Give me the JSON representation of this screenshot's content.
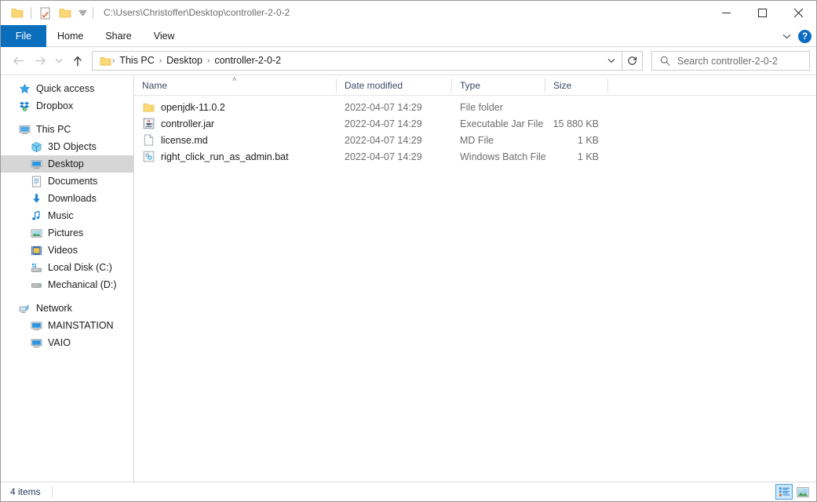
{
  "window": {
    "path_title": "C:\\Users\\Christoffer\\Desktop\\controller-2-0-2",
    "minimize_label": "Minimize",
    "maximize_label": "Maximize",
    "close_label": "Close"
  },
  "quick_access_toolbar": {
    "items": [
      {
        "name": "folder-icon",
        "label": "Explorer"
      },
      {
        "name": "properties-icon",
        "label": "Properties"
      },
      {
        "name": "new-folder-icon",
        "label": "New folder"
      },
      {
        "name": "chevron-down-icon",
        "label": "Customize Quick Access Toolbar"
      }
    ]
  },
  "ribbon": {
    "tabs": [
      {
        "label": "File",
        "active": true
      },
      {
        "label": "Home",
        "active": false
      },
      {
        "label": "Share",
        "active": false
      },
      {
        "label": "View",
        "active": false
      }
    ],
    "collapse_label": "Minimize the Ribbon",
    "help_label": "?"
  },
  "address": {
    "back_label": "Back",
    "forward_label": "Forward",
    "recent_label": "Recent locations",
    "up_label": "Up to Desktop",
    "breadcrumbs": [
      "This PC",
      "Desktop",
      "controller-2-0-2"
    ],
    "separator": "›",
    "dropdown_label": "Previous locations",
    "refresh_label": "Refresh"
  },
  "search": {
    "placeholder": "Search controller-2-0-2",
    "icon": "search-icon"
  },
  "sidebar": {
    "groups": [
      {
        "items": [
          {
            "label": "Quick access",
            "icon": "star-icon",
            "indent": false,
            "selected": false
          },
          {
            "label": "Dropbox",
            "icon": "dropbox-icon",
            "indent": false,
            "selected": false
          }
        ]
      },
      {
        "items": [
          {
            "label": "This PC",
            "icon": "monitor-icon",
            "indent": false,
            "selected": false
          },
          {
            "label": "3D Objects",
            "icon": "cube-icon",
            "indent": true,
            "selected": false
          },
          {
            "label": "Desktop",
            "icon": "desktop-icon",
            "indent": true,
            "selected": true
          },
          {
            "label": "Documents",
            "icon": "documents-icon",
            "indent": true,
            "selected": false
          },
          {
            "label": "Downloads",
            "icon": "download-icon",
            "indent": true,
            "selected": false
          },
          {
            "label": "Music",
            "icon": "music-note-icon",
            "indent": true,
            "selected": false
          },
          {
            "label": "Pictures",
            "icon": "pictures-icon",
            "indent": true,
            "selected": false
          },
          {
            "label": "Videos",
            "icon": "videos-icon",
            "indent": true,
            "selected": false
          },
          {
            "label": "Local Disk (C:)",
            "icon": "system-drive-icon",
            "indent": true,
            "selected": false
          },
          {
            "label": "Mechanical (D:)",
            "icon": "drive-icon",
            "indent": true,
            "selected": false
          }
        ]
      },
      {
        "items": [
          {
            "label": "Network",
            "icon": "network-icon",
            "indent": false,
            "selected": false
          },
          {
            "label": "MAINSTATION",
            "icon": "computer-icon",
            "indent": true,
            "selected": false
          },
          {
            "label": "VAIO",
            "icon": "computer-icon",
            "indent": true,
            "selected": false
          }
        ]
      }
    ]
  },
  "file_list": {
    "columns": [
      {
        "label": "Name",
        "sorted": "asc"
      },
      {
        "label": "Date modified",
        "sorted": null
      },
      {
        "label": "Type",
        "sorted": null
      },
      {
        "label": "Size",
        "sorted": null
      }
    ],
    "sort_caret": "˄",
    "rows": [
      {
        "name": "openjdk-11.0.2",
        "date": "2022-04-07 14:29",
        "type": "File folder",
        "size": "",
        "icon": "folder-icon"
      },
      {
        "name": "controller.jar",
        "date": "2022-04-07 14:29",
        "type": "Executable Jar File",
        "size": "15 880 KB",
        "icon": "jar-icon"
      },
      {
        "name": "license.md",
        "date": "2022-04-07 14:29",
        "type": "MD File",
        "size": "1 KB",
        "icon": "document-icon"
      },
      {
        "name": "right_click_run_as_admin.bat",
        "date": "2022-04-07 14:29",
        "type": "Windows Batch File",
        "size": "1 KB",
        "icon": "batch-file-icon"
      }
    ]
  },
  "status": {
    "item_count": "4 items",
    "details_view_label": "Details view",
    "icons_view_label": "Large icons view"
  },
  "colors": {
    "accent": "#0b6ebd",
    "help_blue": "#0a6cc4",
    "selection_grey": "#d6d6d6",
    "folder_yellow": "#fcd975",
    "header_text": "#3b4a66",
    "secondary_text": "#6d6d6d"
  }
}
